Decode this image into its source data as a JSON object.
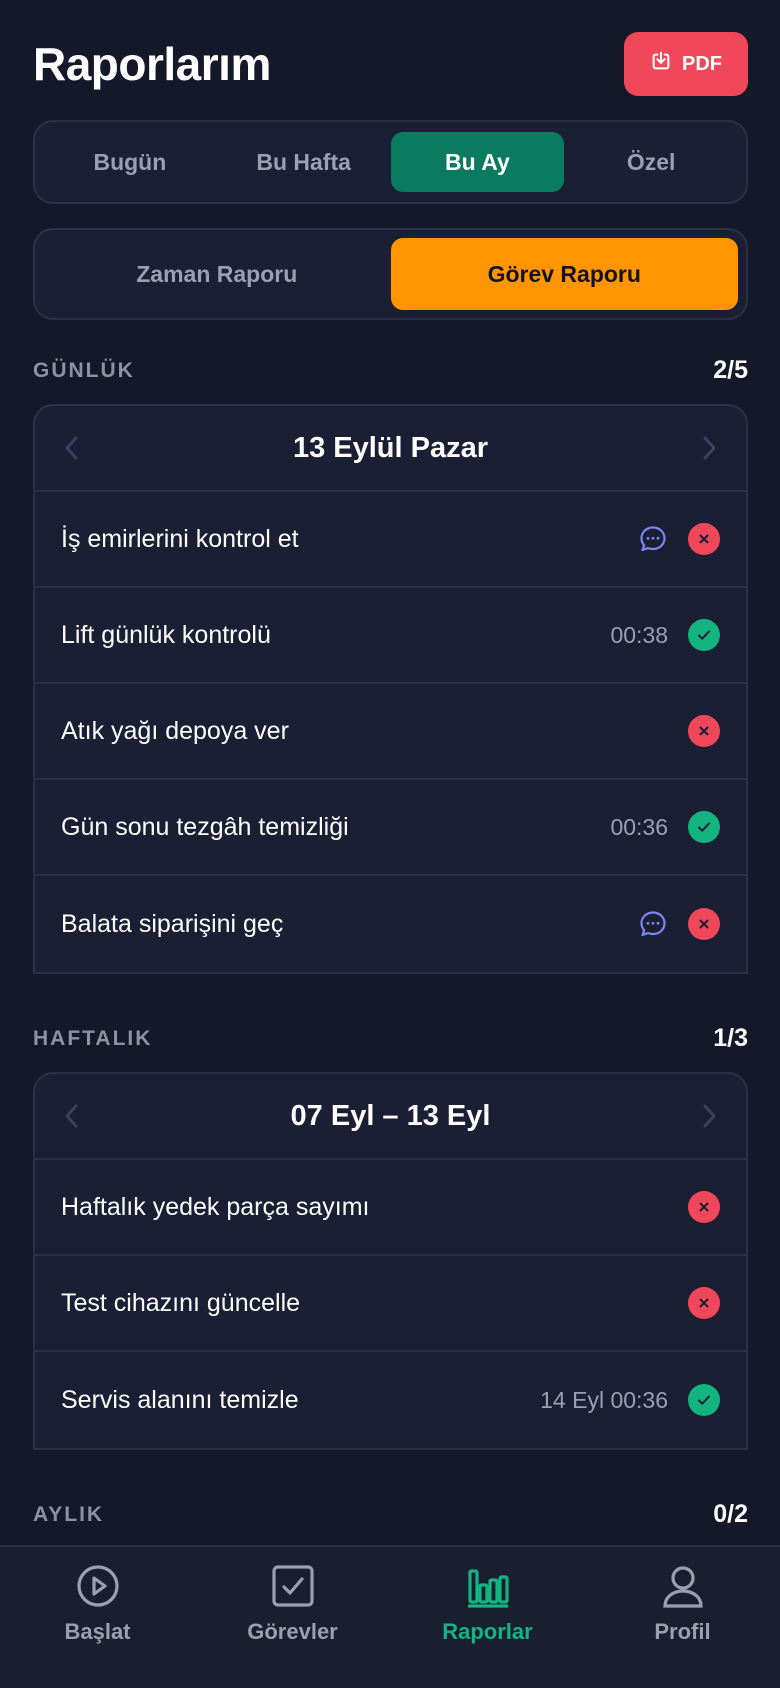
{
  "header": {
    "title": "Raporlarım",
    "pdf_label": "PDF"
  },
  "period_tabs": [
    "Bugün",
    "Bu Hafta",
    "Bu Ay",
    "Özel"
  ],
  "report_tabs": [
    "Zaman Raporu",
    "Görev Raporu"
  ],
  "sections": {
    "daily": {
      "label": "GÜNLÜK",
      "count": "2/5",
      "title": "13 Eylül Pazar",
      "rows": [
        {
          "label": "İş emirlerini kontrol et",
          "time": "",
          "status": "fail",
          "comment": true
        },
        {
          "label": "Lift günlük kontrolü",
          "time": "00:38",
          "status": "done",
          "comment": false
        },
        {
          "label": "Atık yağı depoya ver",
          "time": "",
          "status": "fail",
          "comment": false
        },
        {
          "label": "Gün sonu tezgâh temizliği",
          "time": "00:36",
          "status": "done",
          "comment": false
        },
        {
          "label": "Balata siparişini geç",
          "time": "",
          "status": "fail",
          "comment": true
        }
      ]
    },
    "weekly": {
      "label": "HAFTALIK",
      "count": "1/3",
      "title": "07 Eyl – 13 Eyl",
      "rows": [
        {
          "label": "Haftalık yedek parça sayımı",
          "time": "",
          "status": "fail",
          "comment": false
        },
        {
          "label": "Test cihazını güncelle",
          "time": "",
          "status": "fail",
          "comment": false
        },
        {
          "label": "Servis alanını temizle",
          "time": "14 Eyl 00:36",
          "status": "done",
          "comment": false
        }
      ]
    },
    "monthly": {
      "label": "AYLIK",
      "count": "0/2"
    }
  },
  "nav": [
    "Başlat",
    "Görevler",
    "Raporlar",
    "Profil"
  ],
  "colors": {
    "accent_green": "#13b47f",
    "fail_red": "#f0485a",
    "active_orange": "#ff9500"
  }
}
